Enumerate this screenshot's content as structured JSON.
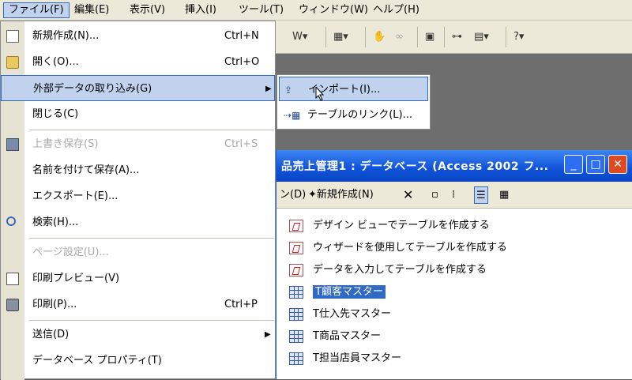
{
  "menubar": {
    "items": [
      {
        "label": "ファイル(F)"
      },
      {
        "label": "編集(E)"
      },
      {
        "label": "表示(V)"
      },
      {
        "label": "挿入(I)"
      },
      {
        "label": "ツール(T)"
      },
      {
        "label": "ウィンドウ(W)"
      },
      {
        "label": "ヘルプ(H)"
      }
    ]
  },
  "file_menu": {
    "items": [
      {
        "label": "新規作成(N)...",
        "shortcut": "Ctrl+N",
        "icon": "new-document-icon"
      },
      {
        "label": "開く(O)...",
        "shortcut": "Ctrl+O",
        "icon": "open-folder-icon"
      },
      {
        "label": "外部データの取り込み(G)",
        "icon": "",
        "submenu": true
      },
      {
        "label": "閉じる(C)"
      },
      {
        "label": "上書き保存(S)",
        "shortcut": "Ctrl+S",
        "icon": "save-disk-icon",
        "disabled": true
      },
      {
        "label": "名前を付けて保存(A)..."
      },
      {
        "label": "エクスポート(E)..."
      },
      {
        "label": "検索(H)...",
        "icon": "search-icon"
      },
      {
        "label": "ページ設定(U)...",
        "disabled": true
      },
      {
        "label": "印刷プレビュー(V)",
        "icon": "print-preview-icon"
      },
      {
        "label": "印刷(P)...",
        "shortcut": "Ctrl+P",
        "icon": "printer-icon"
      },
      {
        "label": "送信(D)",
        "submenu": true
      },
      {
        "label": "データベース プロパティ(T)"
      }
    ]
  },
  "submenu": {
    "items": [
      {
        "label": "インポート(I)...",
        "icon": "import-icon"
      },
      {
        "label": "テーブルのリンク(L)...",
        "icon": "link-table-icon"
      }
    ]
  },
  "db_window": {
    "title": "品売上管理1 : データベース (Access 2002 フ...",
    "toolbar": {
      "design_label": "ン(D)",
      "new_label": "新規作成(N)"
    },
    "objects": [
      {
        "label": "デザイン ビューでテーブルを作成する",
        "kind": "wizard"
      },
      {
        "label": "ウィザードを使用してテーブルを作成する",
        "kind": "wizard"
      },
      {
        "label": "データを入力してテーブルを作成する",
        "kind": "wizard"
      },
      {
        "label": "T顧客マスター",
        "kind": "table",
        "selected": true
      },
      {
        "label": "T仕入先マスター",
        "kind": "table"
      },
      {
        "label": "T商品マスター",
        "kind": "table"
      },
      {
        "label": "T担当店員マスター",
        "kind": "table"
      }
    ]
  },
  "colors": {
    "menu_highlight": "#c1d2ee",
    "title_bar": "#1052d8",
    "selection": "#316ac5",
    "close_button": "#e04a20"
  }
}
